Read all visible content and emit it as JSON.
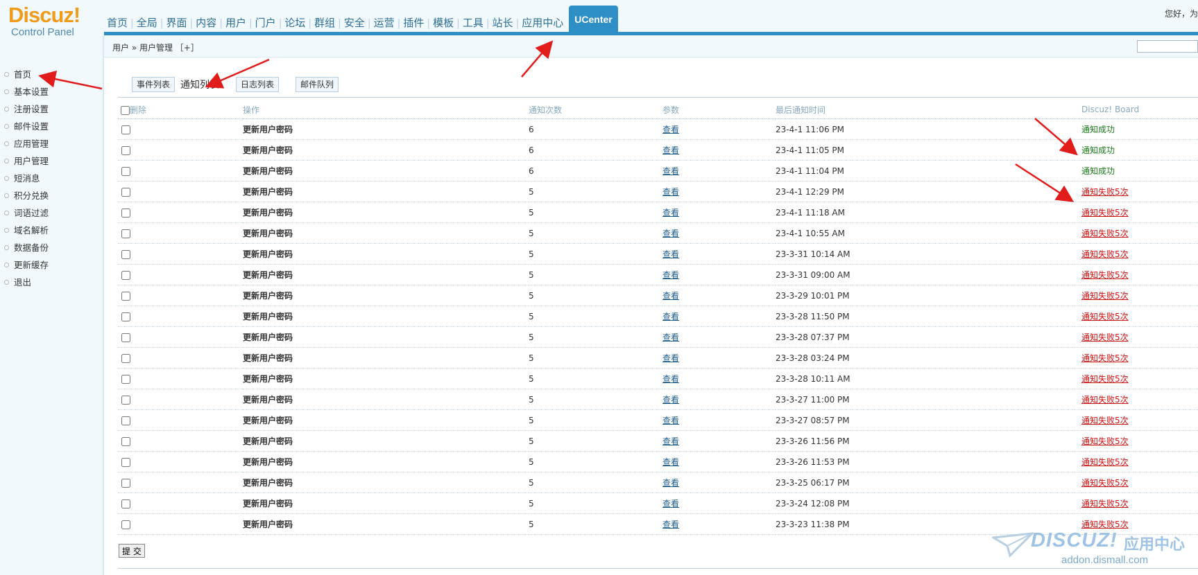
{
  "header": {
    "logo_brand": "Discuz!",
    "logo_sub": "Control Panel",
    "greeting": "您好，为",
    "nav": [
      "首页",
      "全局",
      "界面",
      "内容",
      "用户",
      "门户",
      "论坛",
      "群组",
      "安全",
      "运营",
      "插件",
      "模板",
      "工具",
      "站长",
      "应用中心"
    ],
    "nav_active": "UCenter"
  },
  "breadcrumb": {
    "text": "用户 » 用户管理 ［+］"
  },
  "sidebar": {
    "items": [
      "首页",
      "基本设置",
      "注册设置",
      "邮件设置",
      "应用管理",
      "用户管理",
      "短消息",
      "积分兑换",
      "词语过滤",
      "域名解析",
      "数据备份",
      "更新缓存",
      "退出"
    ]
  },
  "tabs": {
    "events": "事件列表",
    "current": "通知列表",
    "logs": "日志列表",
    "mail": "邮件队列"
  },
  "table": {
    "headers": {
      "delete": "删除",
      "operation": "操作",
      "count": "通知次数",
      "params": "参数",
      "last_time": "最后通知时间",
      "app": "Discuz! Board"
    },
    "rows": [
      {
        "op": "更新用户密码",
        "count": "6",
        "view": "查看",
        "time": "23-4-1 11:06 PM",
        "status": "通知成功",
        "ok": true
      },
      {
        "op": "更新用户密码",
        "count": "6",
        "view": "查看",
        "time": "23-4-1 11:05 PM",
        "status": "通知成功",
        "ok": true
      },
      {
        "op": "更新用户密码",
        "count": "6",
        "view": "查看",
        "time": "23-4-1 11:04 PM",
        "status": "通知成功",
        "ok": true
      },
      {
        "op": "更新用户密码",
        "count": "5",
        "view": "查看",
        "time": "23-4-1 12:29 PM",
        "status": "通知失败5次",
        "ok": false
      },
      {
        "op": "更新用户密码",
        "count": "5",
        "view": "查看",
        "time": "23-4-1 11:18 AM",
        "status": "通知失败5次",
        "ok": false
      },
      {
        "op": "更新用户密码",
        "count": "5",
        "view": "查看",
        "time": "23-4-1 10:55 AM",
        "status": "通知失败5次",
        "ok": false
      },
      {
        "op": "更新用户密码",
        "count": "5",
        "view": "查看",
        "time": "23-3-31 10:14 AM",
        "status": "通知失败5次",
        "ok": false
      },
      {
        "op": "更新用户密码",
        "count": "5",
        "view": "查看",
        "time": "23-3-31 09:00 AM",
        "status": "通知失败5次",
        "ok": false
      },
      {
        "op": "更新用户密码",
        "count": "5",
        "view": "查看",
        "time": "23-3-29 10:01 PM",
        "status": "通知失败5次",
        "ok": false
      },
      {
        "op": "更新用户密码",
        "count": "5",
        "view": "查看",
        "time": "23-3-28 11:50 PM",
        "status": "通知失败5次",
        "ok": false
      },
      {
        "op": "更新用户密码",
        "count": "5",
        "view": "查看",
        "time": "23-3-28 07:37 PM",
        "status": "通知失败5次",
        "ok": false
      },
      {
        "op": "更新用户密码",
        "count": "5",
        "view": "查看",
        "time": "23-3-28 03:24 PM",
        "status": "通知失败5次",
        "ok": false
      },
      {
        "op": "更新用户密码",
        "count": "5",
        "view": "查看",
        "time": "23-3-28 10:11 AM",
        "status": "通知失败5次",
        "ok": false
      },
      {
        "op": "更新用户密码",
        "count": "5",
        "view": "查看",
        "time": "23-3-27 11:00 PM",
        "status": "通知失败5次",
        "ok": false
      },
      {
        "op": "更新用户密码",
        "count": "5",
        "view": "查看",
        "time": "23-3-27 08:57 PM",
        "status": "通知失败5次",
        "ok": false
      },
      {
        "op": "更新用户密码",
        "count": "5",
        "view": "查看",
        "time": "23-3-26 11:56 PM",
        "status": "通知失败5次",
        "ok": false
      },
      {
        "op": "更新用户密码",
        "count": "5",
        "view": "查看",
        "time": "23-3-26 11:53 PM",
        "status": "通知失败5次",
        "ok": false
      },
      {
        "op": "更新用户密码",
        "count": "5",
        "view": "查看",
        "time": "23-3-25 06:17 PM",
        "status": "通知失败5次",
        "ok": false
      },
      {
        "op": "更新用户密码",
        "count": "5",
        "view": "查看",
        "time": "23-3-24 12:08 PM",
        "status": "通知失败5次",
        "ok": false
      },
      {
        "op": "更新用户密码",
        "count": "5",
        "view": "查看",
        "time": "23-3-23 11:38 PM",
        "status": "通知失败5次",
        "ok": false
      }
    ]
  },
  "submit_label": "提 交",
  "watermark": {
    "brand": "DISCUZ!",
    "cn": "应用中心",
    "url": "addon.dismall.com"
  },
  "colors": {
    "accent": "#2d8fc5",
    "ok": "#1a7a1a",
    "fail": "#cc1111",
    "annotation": "#e21b1b"
  }
}
